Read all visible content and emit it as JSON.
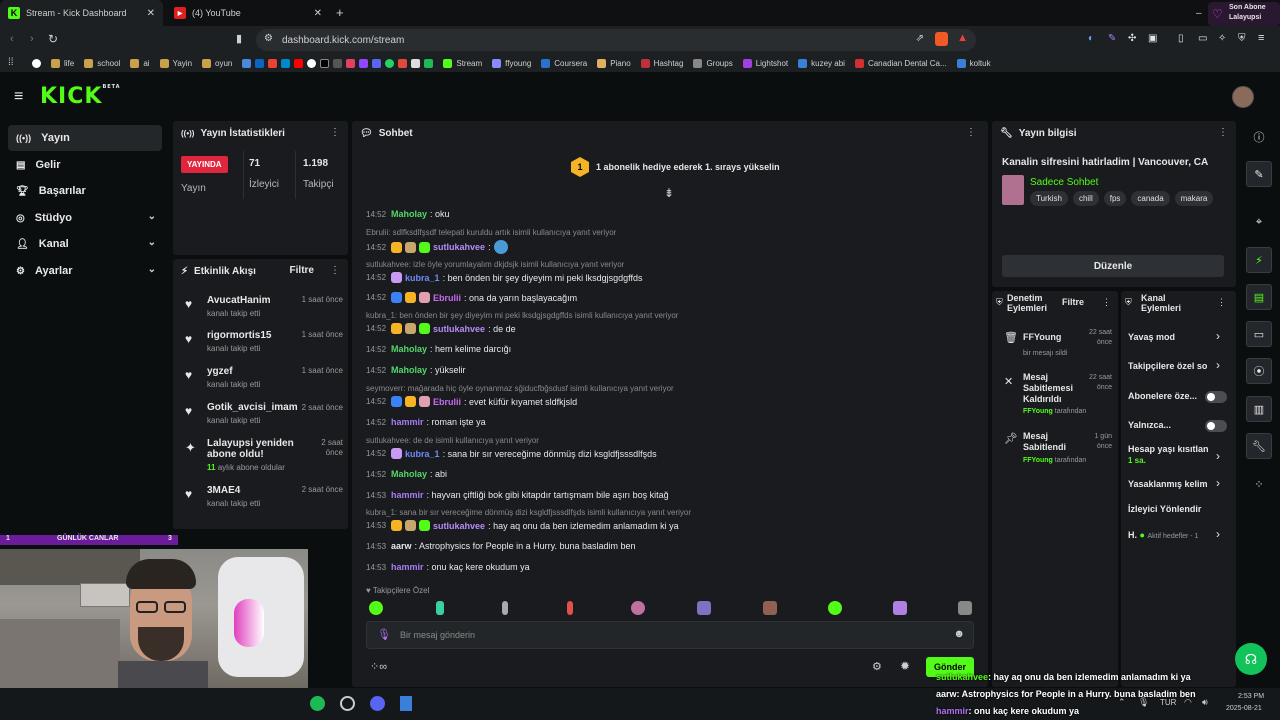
{
  "browser": {
    "tabs": [
      {
        "title": "Stream - Kick Dashboard",
        "active": true
      },
      {
        "title": "(4) YouTube",
        "active": false
      }
    ],
    "new_tab": "+",
    "url": "dashboard.kick.com/stream",
    "notification": {
      "line1": "Son Abone",
      "line2": "Lalayupsi"
    },
    "bookmarks": [
      "life",
      "school",
      "ai",
      "Yayin",
      "oyun",
      "Stream",
      "ffyoung",
      "Coursera",
      "Piano",
      "Hashtag",
      "Groups",
      "Lightshot",
      "kuzey abi",
      "Canadian Dental Ca...",
      "koltuk"
    ]
  },
  "kick": {
    "logo": "KICK",
    "logo_sup": "BETA",
    "nav": [
      {
        "label": "Yayın",
        "icon": "broadcast-icon",
        "active": true,
        "chevron": false
      },
      {
        "label": "Gelir",
        "icon": "wallet-icon",
        "active": false,
        "chevron": false
      },
      {
        "label": "Başarılar",
        "icon": "trophy-icon",
        "active": false,
        "chevron": false
      },
      {
        "label": "Stüdyo",
        "icon": "studio-icon",
        "active": false,
        "chevron": true
      },
      {
        "label": "Kanal",
        "icon": "user-icon",
        "active": false,
        "chevron": true
      },
      {
        "label": "Ayarlar",
        "icon": "gear-icon",
        "active": false,
        "chevron": true
      }
    ]
  },
  "stats": {
    "title": "Yayın İstatistikleri",
    "live_badge": "YAYINDA",
    "live_label": "Yayın",
    "viewers": "71",
    "viewers_label": "İzleyici",
    "followers": "1.198",
    "followers_label": "Takipçi"
  },
  "activity": {
    "title": "Etkinlik Akışı",
    "filter": "Filtre",
    "events": [
      {
        "name": "AvucatHanim",
        "sub": "kanalı takip etti",
        "time": "1 saat önce",
        "icon": "heart"
      },
      {
        "name": "rigormortis15",
        "sub": "kanalı takip etti",
        "time": "1 saat önce",
        "icon": "heart"
      },
      {
        "name": "ygzef",
        "sub": "kanalı takip etti",
        "time": "1 saat önce",
        "icon": "heart"
      },
      {
        "name": "Gotik_avcisi_imam",
        "sub": "kanalı takip etti",
        "time": "2 saat önce",
        "icon": "heart"
      },
      {
        "name": "Lalayupsi yeniden abone oldu!",
        "sub": "aylık abone oldular",
        "sub_num": "11",
        "time": "2 saat önce",
        "icon": "star"
      },
      {
        "name": "3MAE4",
        "sub": "kanalı takip etti",
        "time": "2 saat önce",
        "icon": "heart"
      }
    ]
  },
  "webcam_label": {
    "left": "1",
    "mid": "GÜNLÜK CANLAR",
    "right": "3"
  },
  "chat": {
    "title": "Sohbet",
    "goal": "1 abonelik hediye ederek 1. sırays yükselin",
    "goal_rank": "1",
    "lines": [
      {
        "type": "msg",
        "ts": "14:52",
        "user": "Maholay",
        "color": "#54d66a",
        "text": ": oku",
        "badges": []
      },
      {
        "type": "reply",
        "text": "Ebrulii: sdlfksdlfşsdf telepati kuruldu artık isimli kullanıcıya yanıt veriyor"
      },
      {
        "type": "msg",
        "ts": "14:52",
        "user": "sutlukahvee",
        "color": "#b58cf5",
        "text": ":",
        "badges": [
          "#f5b325",
          "#c9a66b",
          "#53fc18"
        ],
        "emote": true
      },
      {
        "type": "reply",
        "text": "sutlukahvee: izle öyle yorumlayalım dkjdsjk isimli kullanıcıya yanıt veriyor"
      },
      {
        "type": "msg",
        "ts": "14:52",
        "user": "kubra_1",
        "color": "#6d8cf7",
        "text": ": ben önden bir şey diyeyim mi peki lksdgjsgdgffds",
        "badges": [
          "#c99bf5"
        ]
      },
      {
        "type": "msg",
        "ts": "14:52",
        "user": "Ebrulii",
        "color": "#c86cf0",
        "text": ": ona da yarın başlayacağım",
        "badges": [
          "#3b82f6",
          "#f5b325",
          "#e0a0b0"
        ]
      },
      {
        "type": "reply",
        "text": "kubra_1: ben önden bir şey diyeyim mi peki lksdgjsgdgffds isimli kullanıcıya yanıt veriyor"
      },
      {
        "type": "msg",
        "ts": "14:52",
        "user": "sutlukahvee",
        "color": "#b58cf5",
        "text": ": de de",
        "badges": [
          "#f5b325",
          "#c9a66b",
          "#53fc18"
        ]
      },
      {
        "type": "msg",
        "ts": "14:52",
        "user": "Maholay",
        "color": "#54d66a",
        "text": ": hem kelime darcığı",
        "badges": []
      },
      {
        "type": "msg",
        "ts": "14:52",
        "user": "Maholay",
        "color": "#54d66a",
        "text": ": yükselir",
        "badges": []
      },
      {
        "type": "reply",
        "text": "seymoverr: mağarada hiç öyle oynanmaz sğiducfbğsdusf isimli kullanıcıya yanıt veriyor"
      },
      {
        "type": "msg",
        "ts": "14:52",
        "user": "Ebrulii",
        "color": "#c86cf0",
        "text": ": evet küfür kıyamet sldfkjsld",
        "badges": [
          "#3b82f6",
          "#f5b325",
          "#e0a0b0"
        ]
      },
      {
        "type": "msg",
        "ts": "14:52",
        "user": "hammir",
        "color": "#a67cf2",
        "text": ": roman işte ya",
        "badges": []
      },
      {
        "type": "reply",
        "text": "sutlukahvee: de de isimli kullanıcıya yanıt veriyor"
      },
      {
        "type": "msg",
        "ts": "14:52",
        "user": "kubra_1",
        "color": "#6d8cf7",
        "text": ": sana bir sır vereceğime dönmüş dizi ksgldfjsssdlfşds",
        "badges": [
          "#c99bf5"
        ]
      },
      {
        "type": "msg",
        "ts": "14:52",
        "user": "Maholay",
        "color": "#54d66a",
        "text": ": abi",
        "badges": []
      },
      {
        "type": "msg",
        "ts": "14:53",
        "user": "hammir",
        "color": "#a67cf2",
        "text": ": hayvan çiftliği bok gibi kitapdır tartışmam bile aşırı boş kitağ",
        "badges": []
      },
      {
        "type": "reply",
        "text": "kubra_1: sana bir sır vereceğime dönmüş dizi ksgldfjsssdlfşds isimli kullanıcıya yanıt veriyor"
      },
      {
        "type": "msg",
        "ts": "14:53",
        "user": "sutlukahvee",
        "color": "#b58cf5",
        "text": ": hay aq onu da ben izlemedim anlamadım ki ya",
        "badges": [
          "#f5b325",
          "#c9a66b",
          "#53fc18"
        ]
      },
      {
        "type": "msg",
        "ts": "14:53",
        "user": "aarw",
        "color": "#e8e8e8",
        "text": ": Astrophysics for People in a Hurry. buna basladim ben",
        "badges": []
      },
      {
        "type": "msg",
        "ts": "14:53",
        "user": "hammir",
        "color": "#a67cf2",
        "text": ": onu kaç kere okudum ya",
        "badges": []
      }
    ],
    "emote_section": "Takipçilere Özel",
    "input_placeholder": "Bir mesaj gönderin",
    "send": "Gönder"
  },
  "stream_info": {
    "title": "Yayın bilgisi",
    "stream_title": "Kanalin sifresini hatirladim | Vancouver, CA",
    "category": "Sadece Sohbet",
    "tags": [
      "Turkish",
      "chill",
      "fps",
      "canada",
      "makara"
    ],
    "edit": "Düzenle"
  },
  "mod_actions": {
    "title": "Denetim Eylemleri",
    "filter": "Filtre",
    "items": [
      {
        "name": "FFYoung",
        "sub": "bir mesajı sildi",
        "time": "22 saat önce",
        "icon": "trash-icon"
      },
      {
        "name": "Mesaj Sabitlemesi Kaldırıldı",
        "sub": "tarafından",
        "by": "FFYoung",
        "time": "22 saat önce",
        "icon": "unpin-icon"
      },
      {
        "name": "Mesaj Sabitlendi",
        "sub": "tarafından",
        "by": "FFYoung",
        "time": "1 gün önce",
        "icon": "pin-icon"
      }
    ]
  },
  "channel_actions": {
    "title": "Kanal Eylemleri",
    "items": [
      {
        "label": "Yavaş mod",
        "kind": "chevron"
      },
      {
        "label": "Takipçilere özel so",
        "kind": "chevron"
      },
      {
        "label": "Abonelere öze...",
        "kind": "toggle"
      },
      {
        "label": "Yalnızca...",
        "kind": "toggle"
      },
      {
        "label": "Hesap yaşı kısıtlan",
        "sub": "1 sa.",
        "kind": "chevron"
      },
      {
        "label": "Yasaklanmış kelim",
        "kind": "chevron"
      },
      {
        "label": "İzleyici Yönlendir",
        "kind": "none"
      },
      {
        "label": "H.",
        "sub": "Aktif hedefler - 1",
        "kind": "chevron"
      }
    ]
  },
  "overlay": [
    {
      "user": "sutlukahvee",
      "text": ": hay aq onu da ben izlemedim anlamadım ki ya"
    },
    {
      "user": "aarw",
      "text": ": Astrophysics for People in a Hurry. buna basladim ben"
    },
    {
      "user": "hammir",
      "text": ": onu kaç kere okudum ya"
    }
  ],
  "taskbar": {
    "lang": "TUR",
    "time": "2:53 PM",
    "date": "2025-08-21"
  },
  "colors": {
    "kick_green": "#53fc18",
    "live_red": "#e0263d",
    "panel": "#191b1f",
    "bg": "#0b0e0f"
  }
}
